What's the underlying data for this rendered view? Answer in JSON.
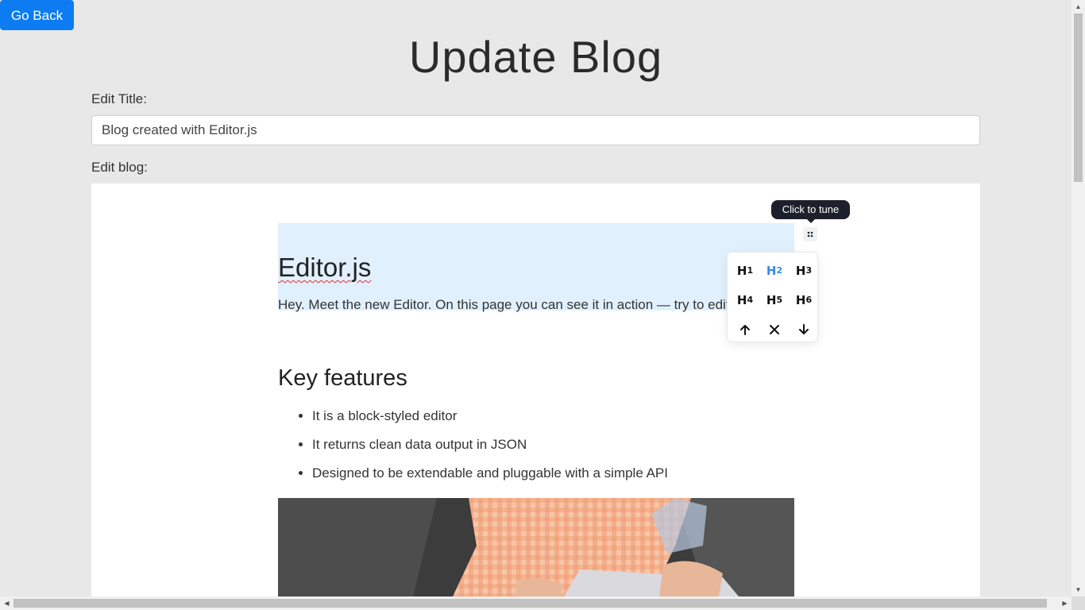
{
  "header": {
    "go_back_label": "Go Back",
    "page_title": "Update Blog"
  },
  "form": {
    "title_label": "Edit Title:",
    "title_value": "Blog created with Editor.js",
    "blog_label": "Edit blog:"
  },
  "editor": {
    "heading": "Editor.js",
    "paragraph": "Hey. Meet the new Editor. On this page you can see it in action — try to edit this text.",
    "subheading": "Key features",
    "features": [
      "It is a block-styled editor",
      "It returns clean data output in JSON",
      "Designed to be extendable and pluggable with a simple API"
    ]
  },
  "tune_menu": {
    "tooltip": "Click to tune",
    "heading_levels": [
      {
        "letter": "H",
        "level": "1"
      },
      {
        "letter": "H",
        "level": "2"
      },
      {
        "letter": "H",
        "level": "3"
      },
      {
        "letter": "H",
        "level": "4"
      },
      {
        "letter": "H",
        "level": "5"
      },
      {
        "letter": "H",
        "level": "6"
      }
    ],
    "active_level": "2",
    "actions": [
      "move-up",
      "delete",
      "move-down"
    ],
    "accent_color": "#388ae5"
  },
  "colors": {
    "go_back_bg": "#0d7cf2",
    "selection_bg": "#e1f0fd",
    "page_bg": "#e8e8e8"
  }
}
